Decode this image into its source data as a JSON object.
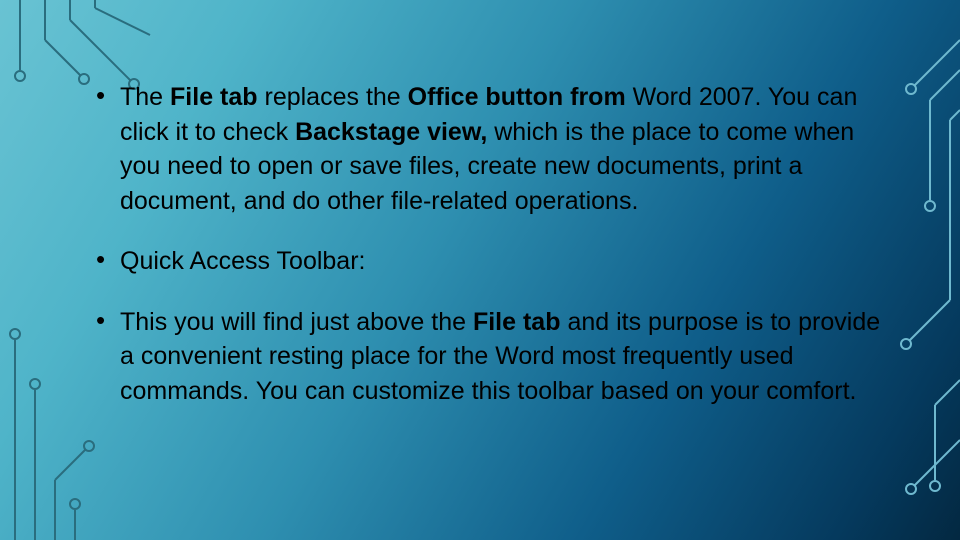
{
  "slide": {
    "bullets": [
      {
        "runs": [
          {
            "t": "The ",
            "b": false
          },
          {
            "t": "File tab ",
            "b": true
          },
          {
            "t": "replaces the ",
            "b": false
          },
          {
            "t": "Office button from ",
            "b": true
          },
          {
            "t": "Word 2007. You can click it to check ",
            "b": false
          },
          {
            "t": "Backstage view, ",
            "b": true
          },
          {
            "t": "which is the place to come when you need to open or save files, create new documents, print a document, and do other file-related operations.",
            "b": false
          }
        ]
      },
      {
        "runs": [
          {
            "t": "Quick Access Toolbar:",
            "b": false
          }
        ]
      },
      {
        "runs": [
          {
            "t": "This you will find just above the ",
            "b": false
          },
          {
            "t": "File tab ",
            "b": true
          },
          {
            "t": "and its purpose is to provide a convenient resting place for the Word most frequently used commands. You can customize this toolbar based on your comfort.",
            "b": false
          }
        ]
      }
    ]
  }
}
